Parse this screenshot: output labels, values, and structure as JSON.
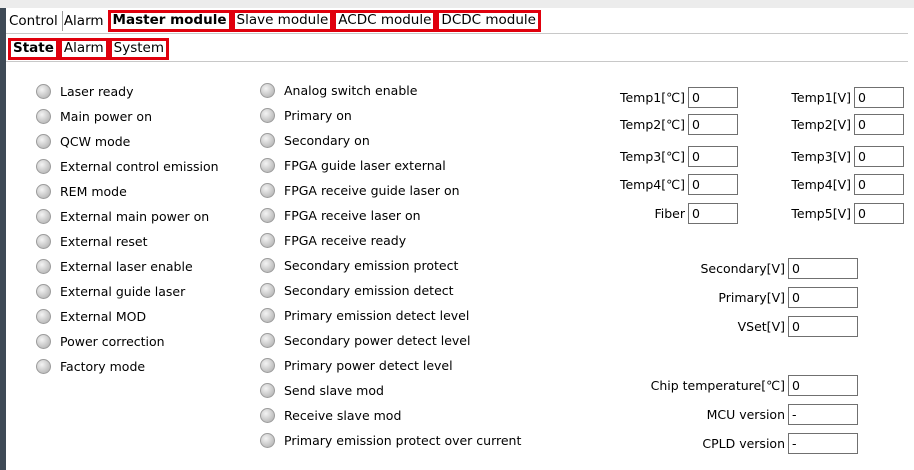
{
  "top_tabs": [
    {
      "label": "Control",
      "highlighted": false,
      "bold": false
    },
    {
      "label": "Alarm",
      "highlighted": false,
      "bold": false
    },
    {
      "label": "Master module",
      "highlighted": true,
      "bold": true
    },
    {
      "label": "Slave module",
      "highlighted": true,
      "bold": false
    },
    {
      "label": "ACDC module",
      "highlighted": true,
      "bold": false
    },
    {
      "label": "DCDC module",
      "highlighted": true,
      "bold": false
    }
  ],
  "sub_tabs": [
    {
      "label": "State",
      "highlighted": true,
      "bold": true
    },
    {
      "label": "Alarm",
      "highlighted": true,
      "bold": false
    },
    {
      "label": "System",
      "highlighted": true,
      "bold": false
    }
  ],
  "indicators_left": [
    "Laser ready",
    "Main power on",
    "QCW mode",
    "External control emission",
    "REM mode",
    "External main power on",
    "External reset",
    "External laser enable",
    "External guide laser",
    "External MOD",
    "Power correction",
    "Factory mode"
  ],
  "indicators_mid": [
    "Analog switch enable",
    "Primary on",
    "Secondary on",
    "FPGA guide laser external",
    "FPGA receive guide laser on",
    "FPGA receive laser on",
    "FPGA receive ready",
    "Secondary emission protect",
    "Secondary emission detect",
    "Primary emission detect level",
    "Secondary power detect level",
    "Primary power detect level",
    "Send slave mod",
    "Receive slave mod",
    "Primary emission protect over current"
  ],
  "fields_temp_c": [
    {
      "label": "Temp1[℃]",
      "value": "0"
    },
    {
      "label": "Temp2[℃]",
      "value": "0"
    },
    {
      "label": "Temp3[℃]",
      "value": "0"
    },
    {
      "label": "Temp4[℃]",
      "value": "0"
    },
    {
      "label": "Fiber",
      "value": "0"
    }
  ],
  "fields_temp_v": [
    {
      "label": "Temp1[V]",
      "value": "0"
    },
    {
      "label": "Temp2[V]",
      "value": "0"
    },
    {
      "label": "Temp3[V]",
      "value": "0"
    },
    {
      "label": "Temp4[V]",
      "value": "0"
    },
    {
      "label": "Temp5[V]",
      "value": "0"
    }
  ],
  "fields_voltage": [
    {
      "label": "Secondary[V]",
      "value": "0"
    },
    {
      "label": "Primary[V]",
      "value": "0"
    },
    {
      "label": "VSet[V]",
      "value": "0"
    }
  ],
  "fields_info": [
    {
      "label": "Chip temperature[℃]",
      "value": "0"
    },
    {
      "label": "MCU version",
      "value": "-"
    },
    {
      "label": "CPLD version",
      "value": "-"
    }
  ],
  "colors": {
    "highlight": "#e0000d",
    "led_off": "#c8c8c8",
    "sidebar": "#3e4a56"
  }
}
